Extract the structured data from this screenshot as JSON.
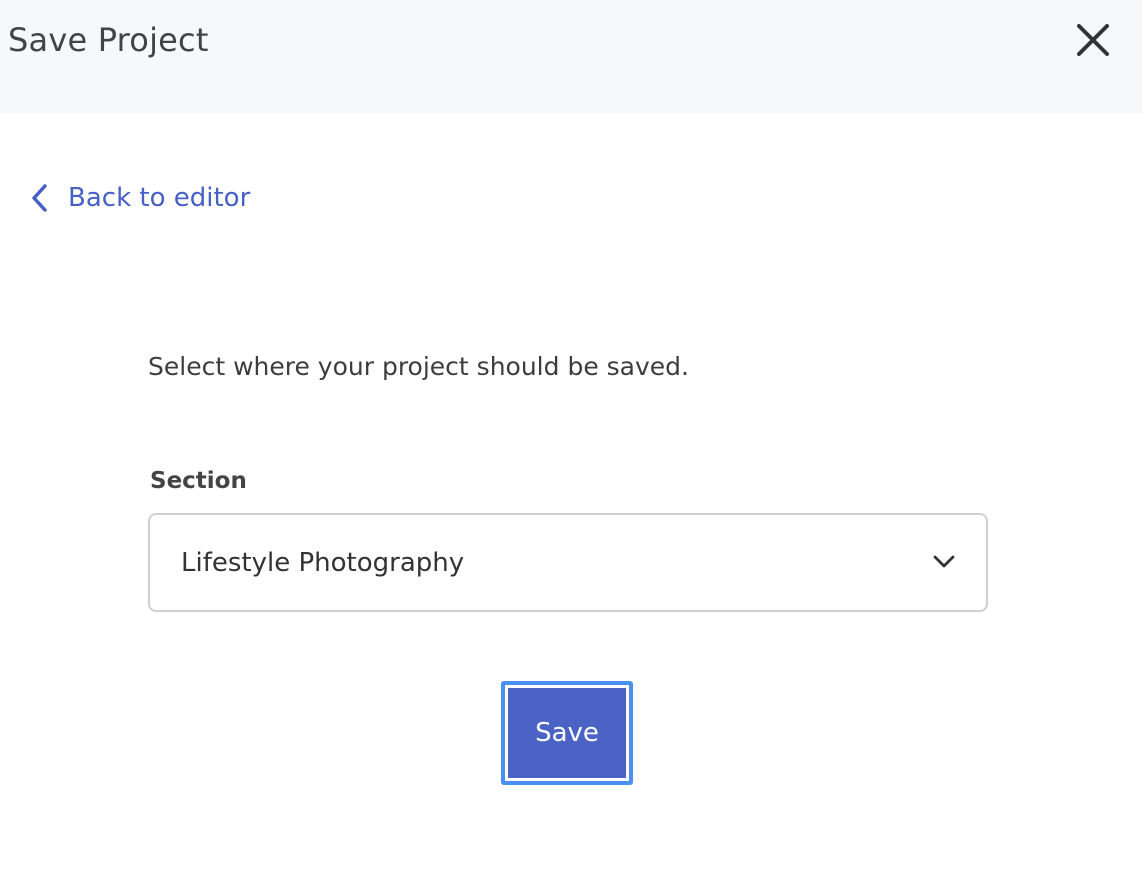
{
  "header": {
    "title": "Save Project",
    "close_icon": "close-icon"
  },
  "nav": {
    "back_label": "Back to editor",
    "back_icon": "chevron-left-icon"
  },
  "main": {
    "intro": "Select where your project should be saved.",
    "section_label": "Section",
    "section_selected": "Lifestyle Photography",
    "dropdown_icon": "chevron-down-icon",
    "save_label": "Save"
  },
  "colors": {
    "header_bg": "#f7f8fa",
    "link": "#4760c5",
    "primary_button": "#4a63c4",
    "focus_ring": "#4a8ff2"
  }
}
